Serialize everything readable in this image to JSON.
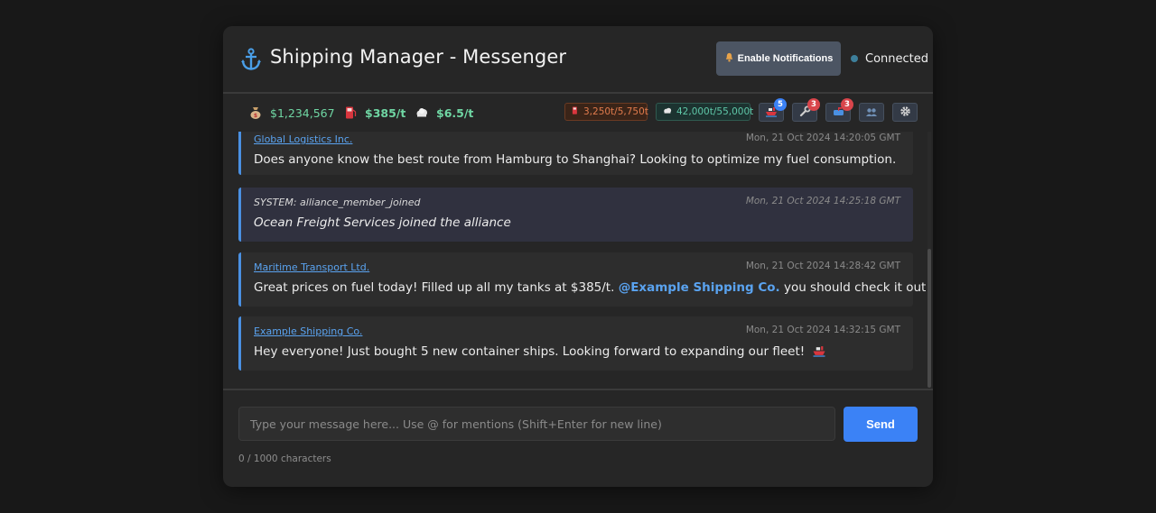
{
  "app": {
    "title": "Shipping Manager - Messenger",
    "icon": "anchor-icon"
  },
  "header": {
    "notify_label": "Enable Notifications",
    "notify_icon": "bell-icon",
    "status_text": "Connected",
    "status_color": "#3d7f9b"
  },
  "stats": {
    "cash": "$1,234,567",
    "fuel_price": "$385/t",
    "co2_price": "$6.5/t",
    "fuel_capacity": "3,250t/5,750t",
    "co2_capacity": "42,000t/55,000t"
  },
  "tools": [
    {
      "name": "ships",
      "icon": "ship-icon",
      "badge": "5",
      "badge_color": "#3b82f6"
    },
    {
      "name": "repairs",
      "icon": "wrench-icon",
      "badge": "3",
      "badge_color": "#d9454b"
    },
    {
      "name": "messages",
      "icon": "mailbox-icon",
      "badge": "3",
      "badge_color": "#d9454b"
    },
    {
      "name": "alliance",
      "icon": "users-icon",
      "badge": null
    },
    {
      "name": "settings",
      "icon": "gear-icon",
      "badge": null
    }
  ],
  "messages": [
    {
      "author": "Global Logistics Inc.",
      "time": "Mon, 21 Oct 2024 14:20:05 GMT",
      "text": "Does anyone know the best route from Hamburg to Shanghai? Looking to optimize my fuel consumption."
    },
    {
      "author": "SYSTEM: alliance_member_joined",
      "time": "Mon, 21 Oct 2024 14:25:18 GMT",
      "text": "Ocean Freight Services joined the alliance"
    },
    {
      "author": "Maritime Transport Ltd.",
      "time": "Mon, 21 Oct 2024 14:28:42 GMT",
      "text_before": "Great prices on fuel today! Filled up all my tanks at $385/t.",
      "mention": "@Example Shipping Co.",
      "text_after": "you should check it out!"
    },
    {
      "author": "Example Shipping Co.",
      "time": "Mon, 21 Oct 2024 14:32:15 GMT",
      "text": "Hey everyone! Just bought 5 new container ships. Looking forward to expanding our fleet!"
    }
  ],
  "composer": {
    "placeholder": "Type your message here... Use @ for mentions (Shift+Enter for new line)",
    "value": "",
    "send_label": "Send",
    "char_count": "0 / 1000 characters"
  },
  "colors": {
    "accent": "#3b82f6",
    "link": "#5aa3f0",
    "price": "#6fd6a3"
  }
}
